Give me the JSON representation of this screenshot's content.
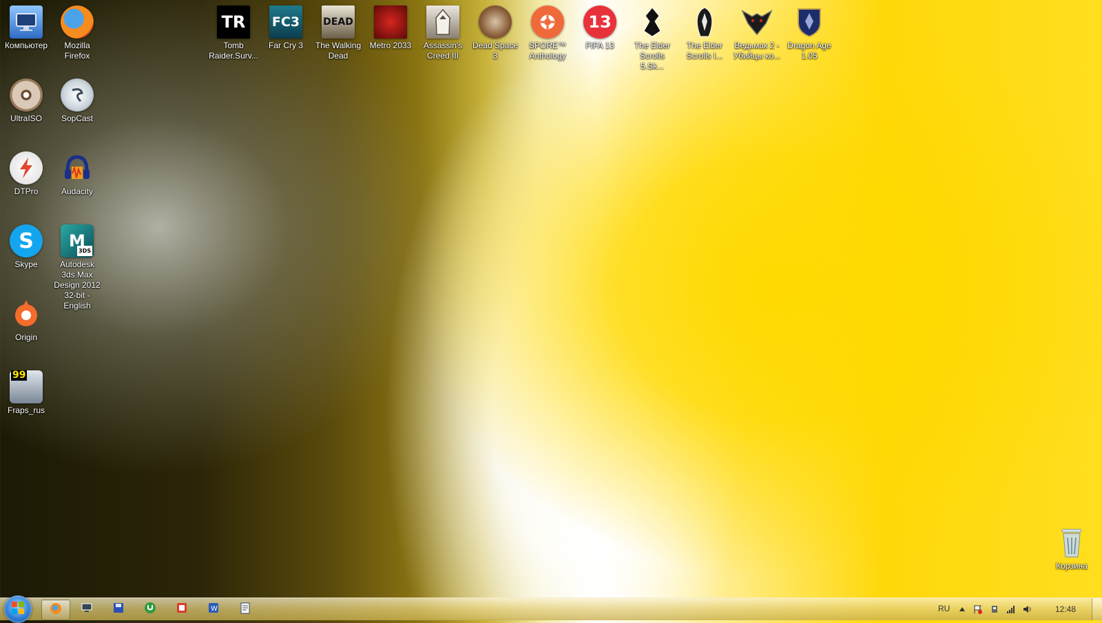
{
  "desktop": {
    "icons": {
      "computer": "Компьютер",
      "firefox": "Mozilla Firefox",
      "ultraiso": "UltraISO",
      "sopcast": "SopCast",
      "dtpro": "DTPro",
      "audacity": "Audacity",
      "skype": "Skype",
      "autodesk": "Autodesk 3ds Max Design 2012 32-bit - English",
      "origin": "Origin",
      "fraps": "Fraps_rus",
      "tomb_raider": "Tomb Raider.Surv...",
      "far_cry": "Far Cry 3",
      "walking_dead": "The Walking Dead",
      "metro": "Metro 2033",
      "assassins": "Assassin's Creed III",
      "dead_space": "Dead Space 3",
      "spore": "SPORE™ Anthology",
      "fifa": "FIFA 13",
      "skyrim": "The Elder Scrolls 5.Sk...",
      "oblivion": "The Elder Scrolls I...",
      "witcher": "Ведьмак 2 - Убийцы ко...",
      "dragon_age": "Dragon Age 1.05",
      "recycle_bin": "Корзина"
    },
    "icon_glyphs": {
      "tomb_raider": "TR",
      "far_cry": "FC3",
      "walking_dead": "DEAD",
      "fifa": "13",
      "fraps": "99",
      "autodesk": "3DS",
      "skype": "S"
    }
  },
  "taskbar": {
    "language": "RU",
    "clock": "12:48",
    "pinned": [
      "firefox-icon",
      "remote-desktop-icon",
      "save-disk-icon",
      "utorrent-icon",
      "pdf-icon",
      "word-icon",
      "notepad-icon"
    ]
  }
}
